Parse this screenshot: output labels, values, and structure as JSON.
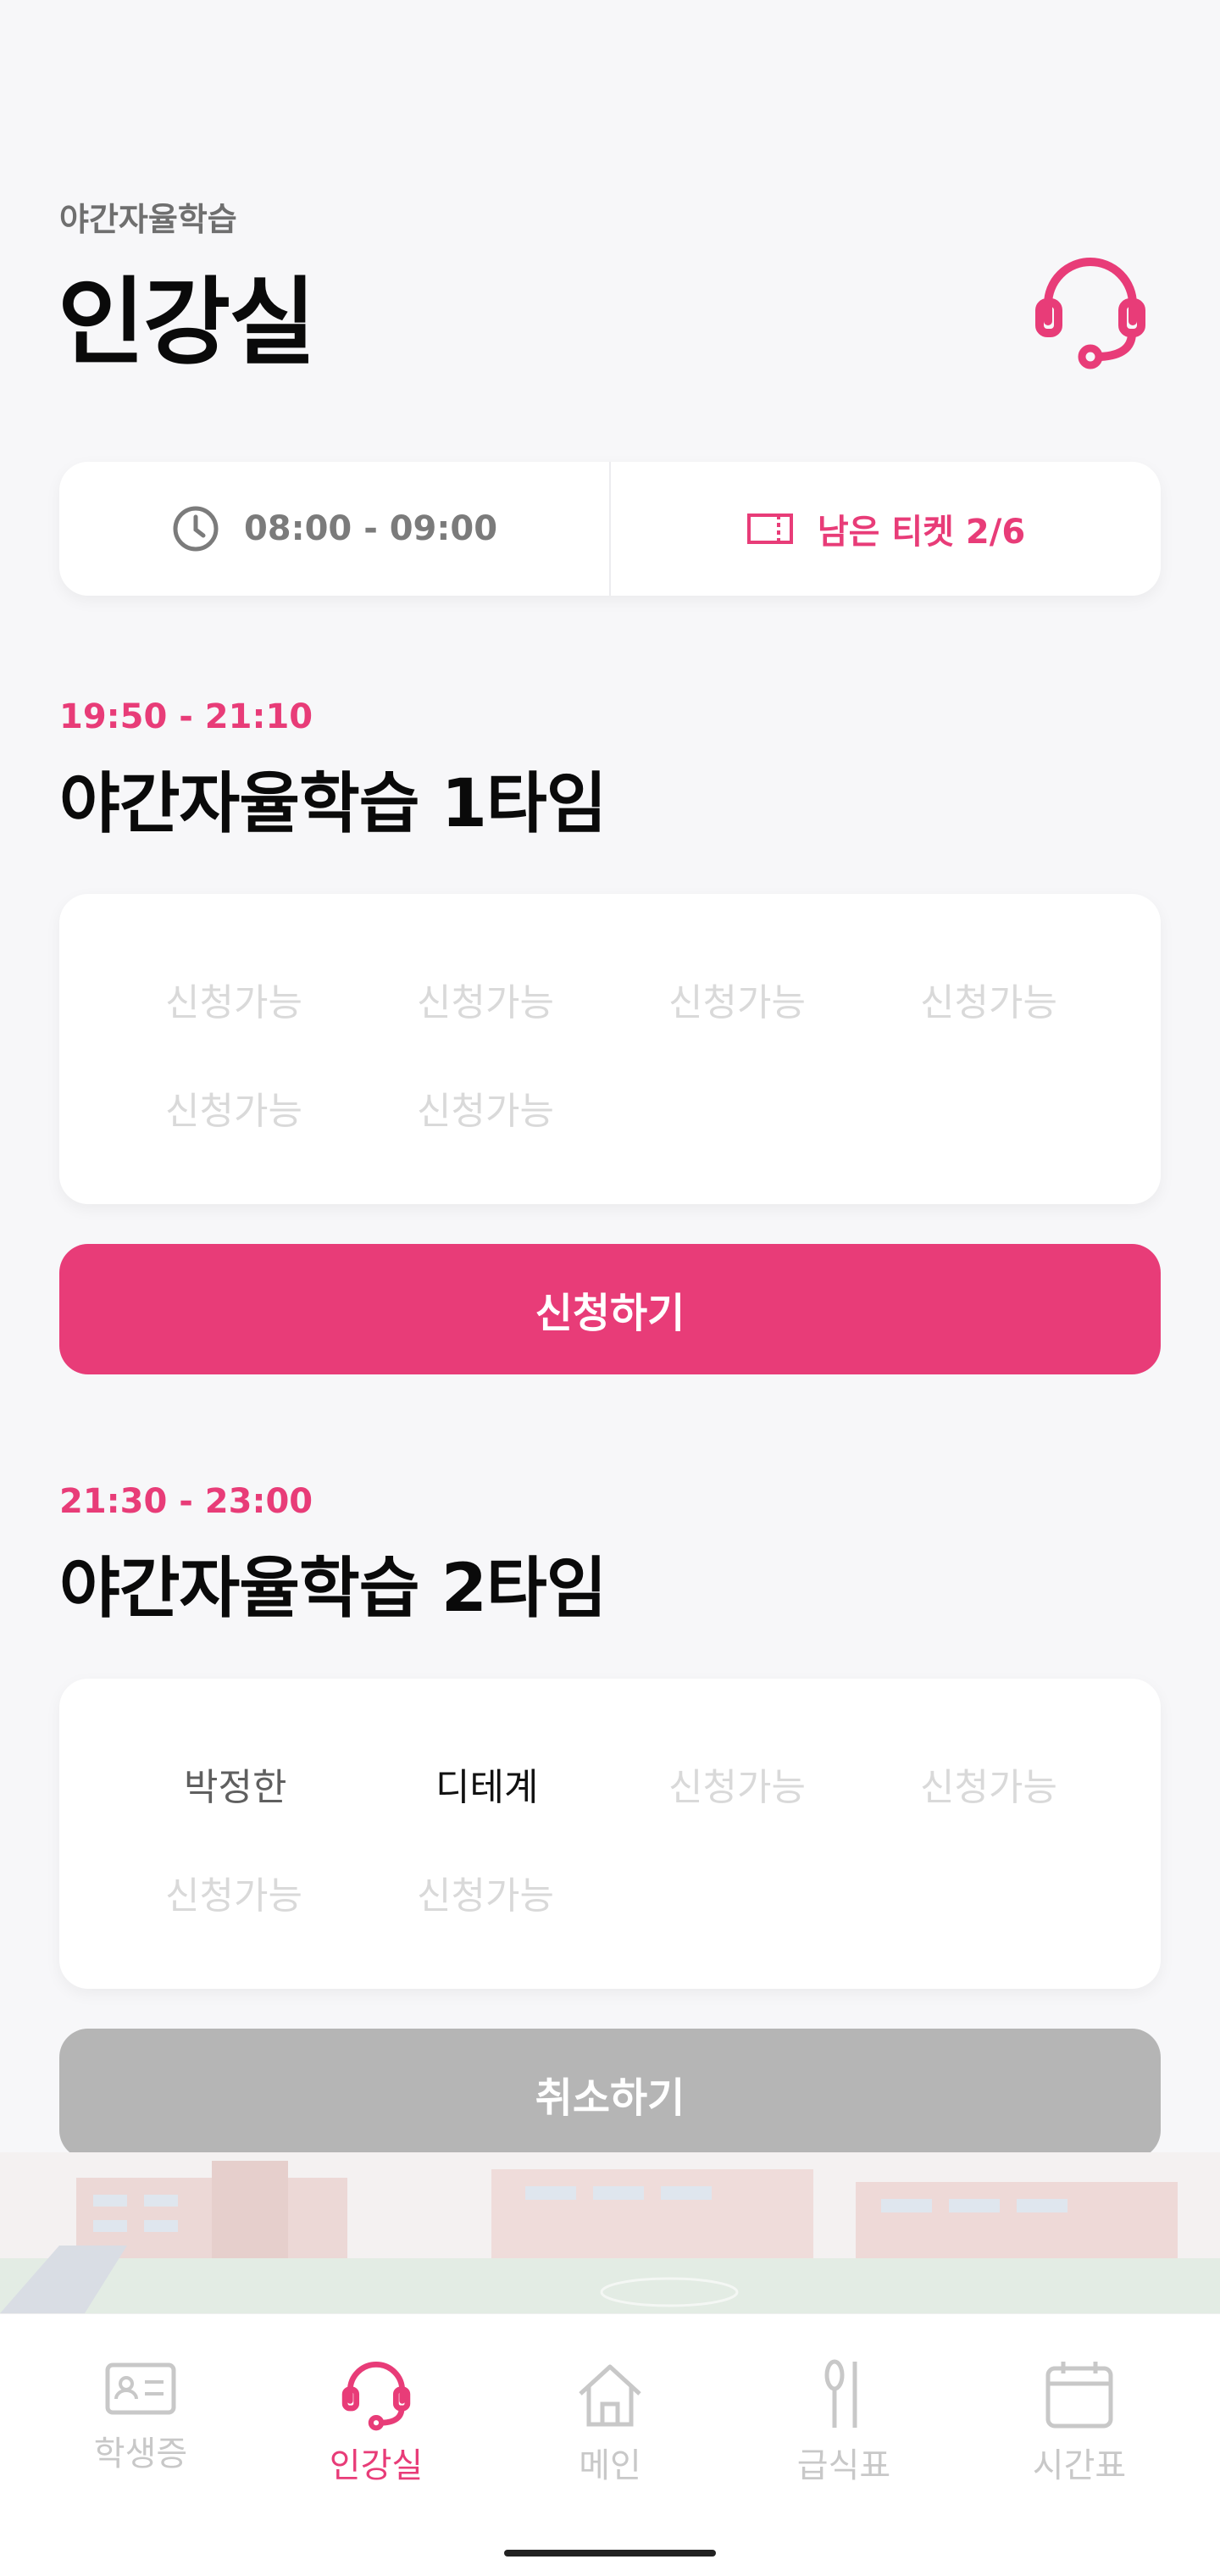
{
  "header": {
    "subtitle": "야간자율학습",
    "title": "인강실"
  },
  "info": {
    "time_range": "08:00 - 09:00",
    "tickets_label": "남은 티켓 2/6"
  },
  "sessions": [
    {
      "time": "19:50 - 21:10",
      "title": "야간자율학습 1타임",
      "seats": [
        "신청가능",
        "신청가능",
        "신청가능",
        "신청가능",
        "신청가능",
        "신청가능"
      ],
      "button_label": "신청하기"
    },
    {
      "time": "21:30 - 23:00",
      "title": "야간자율학습 2타임",
      "seats": [
        "박정한",
        "디테계",
        "신청가능",
        "신청가능",
        "신청가능",
        "신청가능"
      ],
      "button_label": "취소하기"
    }
  ],
  "tabs": [
    {
      "label": "학생증",
      "icon": "id-card-icon"
    },
    {
      "label": "인강실",
      "icon": "headset-icon"
    },
    {
      "label": "메인",
      "icon": "home-icon"
    },
    {
      "label": "급식표",
      "icon": "utensils-icon"
    },
    {
      "label": "시간표",
      "icon": "calendar-icon"
    }
  ],
  "colors": {
    "accent": "#e83c78",
    "disabled": "#b5b5b5",
    "inactive_tab": "#c8c8c8"
  }
}
